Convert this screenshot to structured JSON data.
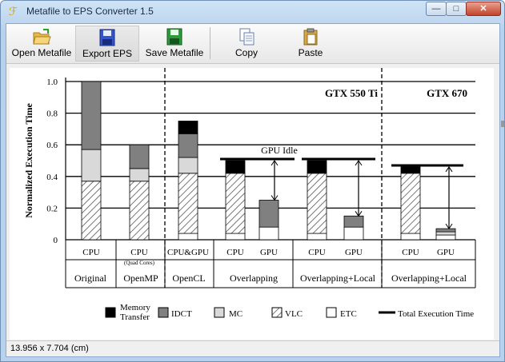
{
  "window": {
    "title": "Metafile to EPS Converter 1.5",
    "buttons": {
      "minimize": "—",
      "maximize": "□",
      "close": "✕"
    }
  },
  "toolbar": {
    "open_label": "Open Metafile",
    "export_label": "Export EPS",
    "save_label": "Save Metafile",
    "copy_label": "Copy",
    "paste_label": "Paste"
  },
  "status": {
    "size": "13.956 x 7.704 (cm)"
  },
  "colors": {
    "idct": "#808080",
    "mc": "#d9d9d9",
    "memory": "#000000"
  },
  "chart_data": {
    "type": "bar",
    "stacked": true,
    "ylabel": "Normalized Execution Time",
    "ylim": [
      0,
      1.0
    ],
    "yticks": [
      "0",
      "0.2",
      "0.4",
      "0.6",
      "0.8",
      "1.0"
    ],
    "ytick_values": [
      0,
      0.2,
      0.4,
      0.6,
      0.8,
      1.0
    ],
    "grid": true,
    "gpu_labels": [
      "GTX 550 Ti",
      "GTX 670"
    ],
    "annotation": "GPU Idle",
    "bars": [
      {
        "label": "CPU",
        "sub": "",
        "etc": 0,
        "vlc": 0.37,
        "mc": 0.2,
        "idct": 0.43,
        "mem": 0
      },
      {
        "label": "CPU",
        "sub": "(Quad Cores)",
        "etc": 0,
        "vlc": 0.37,
        "mc": 0.08,
        "idct": 0.15,
        "mem": 0
      },
      {
        "label": "CPU&GPU",
        "sub": "",
        "etc": 0.04,
        "vlc": 0.38,
        "mc": 0.1,
        "idct": 0.15,
        "mem": 0.08
      },
      {
        "label": "CPU",
        "sub": "",
        "etc": 0.04,
        "vlc": 0.38,
        "mc": 0,
        "idct": 0,
        "mem": 0.08
      },
      {
        "label": "GPU",
        "sub": "",
        "etc": 0.08,
        "vlc": 0,
        "mc": 0,
        "idct": 0.17,
        "mem": 0
      },
      {
        "label": "CPU",
        "sub": "",
        "etc": 0.04,
        "vlc": 0.38,
        "mc": 0,
        "idct": 0,
        "mem": 0.08
      },
      {
        "label": "GPU",
        "sub": "",
        "etc": 0.08,
        "vlc": 0,
        "mc": 0,
        "idct": 0.07,
        "mem": 0
      },
      {
        "label": "CPU",
        "sub": "",
        "etc": 0.04,
        "vlc": 0.38,
        "mc": 0,
        "idct": 0,
        "mem": 0.04
      },
      {
        "label": "GPU",
        "sub": "",
        "etc": 0.03,
        "vlc": 0,
        "mc": 0.02,
        "idct": 0.02,
        "mem": 0
      }
    ],
    "groups": [
      "Original",
      "OpenMP",
      "OpenCL",
      "Overlapping",
      "Overlapping+Local",
      "Overlapping+Local"
    ],
    "total_times": [
      0.51,
      0.51,
      0.47
    ],
    "legend": [
      "Memory",
      "Transfer",
      "IDCT",
      "MC",
      "VLC",
      "ETC",
      "Total Execution Time"
    ]
  }
}
